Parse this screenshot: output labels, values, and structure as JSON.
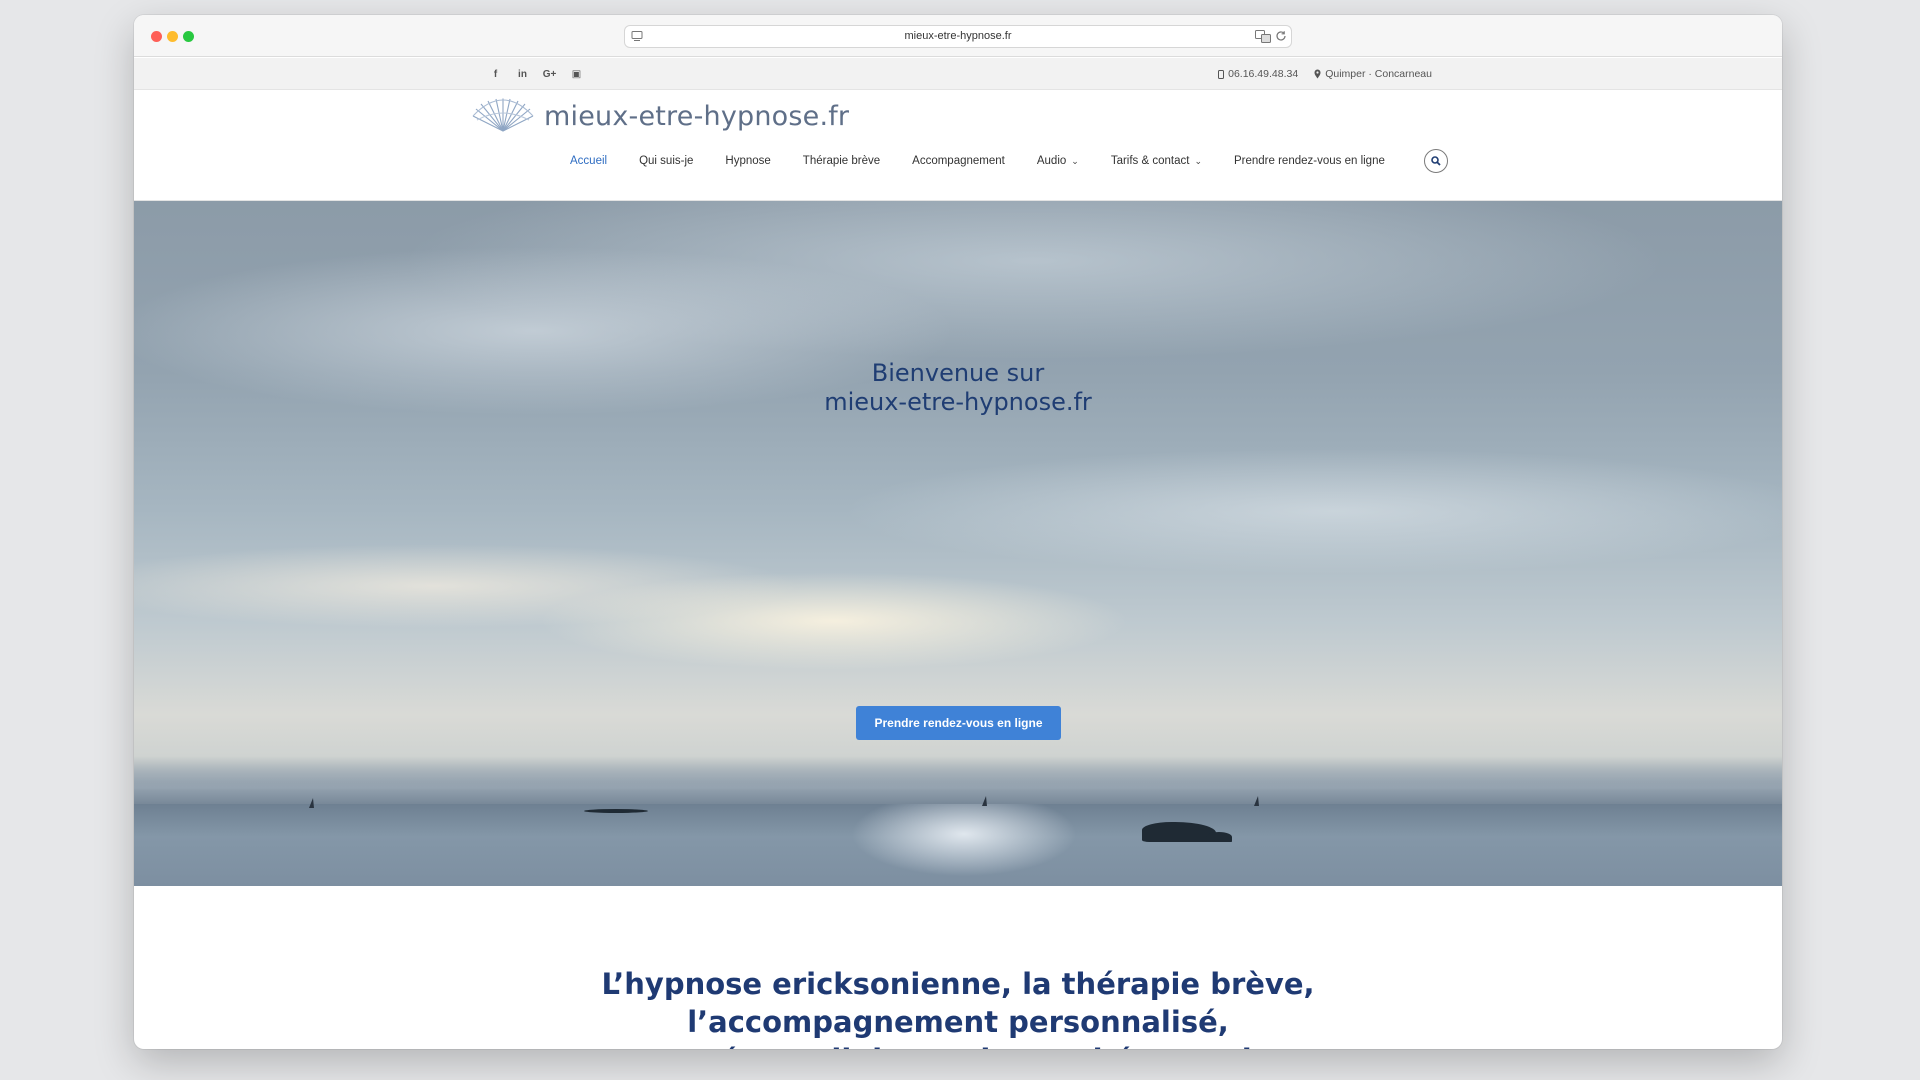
{
  "browser": {
    "url": "mieux-etre-hypnose.fr"
  },
  "topbar": {
    "social": [
      {
        "icon": "facebook-icon",
        "glyph": "f"
      },
      {
        "icon": "linkedin-icon",
        "glyph": "in"
      },
      {
        "icon": "google-plus-icon",
        "glyph": "G+"
      },
      {
        "icon": "youtube-icon",
        "glyph": "▣"
      }
    ],
    "phone": "06.16.49.48.34",
    "location": "Quimper · Concarneau"
  },
  "header": {
    "logo_text": "mieux-etre-hypnose.fr",
    "nav": [
      {
        "label": "Accueil",
        "active": true
      },
      {
        "label": "Qui suis-je"
      },
      {
        "label": "Hypnose"
      },
      {
        "label": "Thérapie brève"
      },
      {
        "label": "Accompagnement"
      },
      {
        "label": "Audio",
        "dropdown": true
      },
      {
        "label": "Tarifs & contact",
        "dropdown": true
      },
      {
        "label": "Prendre rendez-vous en ligne"
      }
    ]
  },
  "hero": {
    "title_line1": "Bienvenue sur",
    "title_line2": "mieux-etre-hypnose.fr",
    "cta_label": "Prendre rendez-vous en ligne"
  },
  "intro": {
    "line1": "L’hypnose ericksonienne, la thérapie brève,",
    "line2": "l’accompagnement personnalisé,",
    "line3": "sont un éventail de pratiques thérapeutiques"
  },
  "colors": {
    "nav_active": "#2f6dc2",
    "title_blue": "#1f3d73",
    "cta_blue": "#3f82d7"
  }
}
